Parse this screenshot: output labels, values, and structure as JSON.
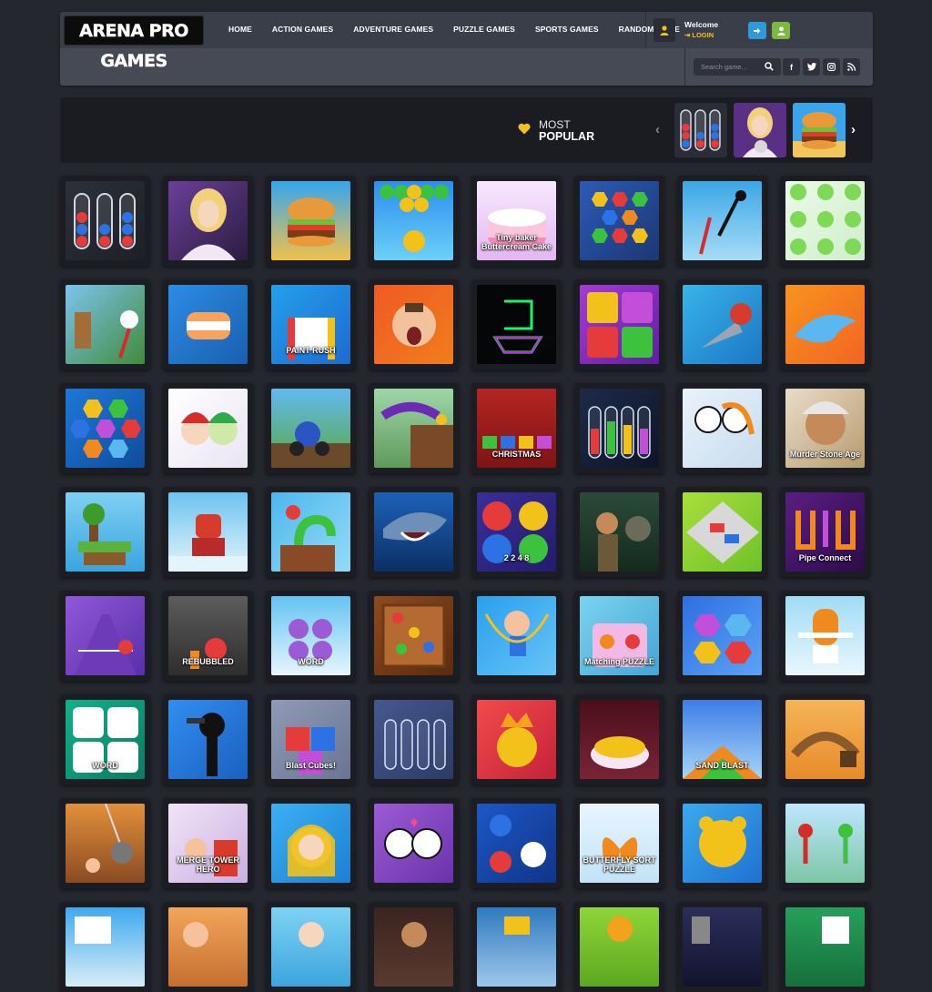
{
  "header": {
    "logo": "ARENA PRO GAMES",
    "nav": [
      "HOME",
      "ACTION GAMES",
      "ADVENTURE GAMES",
      "PUZZLE GAMES",
      "SPORTS GAMES",
      "RANDOM GAME"
    ],
    "welcome": "Welcome",
    "login": "LOGIN",
    "search_placeholder": "Search game...",
    "social": [
      "facebook-icon",
      "twitter-icon",
      "instagram-icon",
      "rss-icon"
    ],
    "colors": {
      "bar": "#3a3e48",
      "login": "#f4c21b",
      "blue": "#2c9bd8",
      "green": "#7cb93d"
    }
  },
  "popular": {
    "most": "MOST",
    "label": "POPULAR",
    "thumbs": [
      "ball sort tubes",
      "girl with cat",
      "burger stack"
    ]
  },
  "tiles": [
    {
      "bg": "linear-gradient(135deg,#2c3038,#1d2026)",
      "motif": "tubes"
    },
    {
      "bg": "linear-gradient(135deg,#6a3f9a,#2b1d40)",
      "motif": "girl"
    },
    {
      "bg": "linear-gradient(180deg,#35a6f0,#f1c04a)",
      "motif": "burger"
    },
    {
      "bg": "linear-gradient(180deg,#2b8ef0,#6cd0f7)",
      "motif": "bubbles"
    },
    {
      "bg": "linear-gradient(180deg,#f6e8ff,#e4b7f2)",
      "motif": "cake",
      "label": "Tiny baker Buttercream Cake"
    },
    {
      "bg": "linear-gradient(135deg,#2a5bb8,#1d3772)",
      "motif": "hex"
    },
    {
      "bg": "linear-gradient(180deg,#3ba7e6,#a7dcf6)",
      "motif": "stick"
    },
    {
      "bg": "linear-gradient(135deg,#eafbe6,#cfeecb)",
      "motif": "numbers"
    },
    {
      "bg": "linear-gradient(135deg,#7ec3ef,#3f8c3a)",
      "motif": "archer"
    },
    {
      "bg": "linear-gradient(135deg,#2b8de4,#1a5fb0)",
      "motif": "sushi"
    },
    {
      "bg": "linear-gradient(135deg,#24a0ea,#1e6ad0)",
      "motif": "paint",
      "label": "PAINT RUSH"
    },
    {
      "bg": "linear-gradient(135deg,#f15a22,#ef7d1d)",
      "motif": "scared"
    },
    {
      "bg": "#050608",
      "motif": "neon"
    },
    {
      "bg": "linear-gradient(135deg,#a43bd8,#5f1f9f)",
      "motif": "stars"
    },
    {
      "bg": "linear-gradient(135deg,#38b4e8,#1b77c6)",
      "motif": "drill"
    },
    {
      "bg": "linear-gradient(135deg,#f7931e,#f26522)",
      "motif": "dolphin"
    },
    {
      "bg": "linear-gradient(135deg,#1d78d8,#104c9c)",
      "motif": "hexnum"
    },
    {
      "bg": "linear-gradient(135deg,#ffffff,#e9e4f3)",
      "motif": "xmasfriends"
    },
    {
      "bg": "linear-gradient(180deg,#62b9f0,#5aa93f)",
      "motif": "hedgehog"
    },
    {
      "bg": "linear-gradient(180deg,#9fd6a8,#5f9a5b)",
      "motif": "worm"
    },
    {
      "bg": "linear-gradient(180deg,#b52423,#7e1415)",
      "motif": "christmas",
      "label": "CHRISTMAS"
    },
    {
      "bg": "linear-gradient(135deg,#1d2a4a,#0d1527)",
      "motif": "colortubes"
    },
    {
      "bg": "linear-gradient(135deg,#e8f2fa,#c8ddee)",
      "motif": "couple"
    },
    {
      "bg": "linear-gradient(135deg,#e9dcc8,#b79b6f)",
      "motif": "murder",
      "label": "Murder Stone Age"
    },
    {
      "bg": "linear-gradient(180deg,#7fd0f2,#3aa4df)",
      "motif": "island"
    },
    {
      "bg": "linear-gradient(180deg,#6dc3f0,#e4f4fb)",
      "motif": "robot"
    },
    {
      "bg": "linear-gradient(135deg,#4eb7ee,#94dbf7)",
      "motif": "snake"
    },
    {
      "bg": "linear-gradient(180deg,#1d61b8,#0d2f66)",
      "motif": "shark"
    },
    {
      "bg": "linear-gradient(135deg,#3a2e98,#241c6c)",
      "motif": "2248",
      "label": "2 2 4 8"
    },
    {
      "bg": "linear-gradient(180deg,#2b4a3a,#142a1f)",
      "motif": "jungle"
    },
    {
      "bg": "linear-gradient(135deg,#a8de3b,#6fc22a)",
      "motif": "cars"
    },
    {
      "bg": "linear-gradient(135deg,#5b1d84,#2c0c48)",
      "motif": "pipe",
      "label": "Pipe Connect"
    },
    {
      "bg": "linear-gradient(135deg,#8f58d9,#5a2fa8)",
      "motif": "tennis"
    },
    {
      "bg": "linear-gradient(180deg,#5c5c5c,#2e2e2e)",
      "motif": "bubbletrouble",
      "label": "REBUBBLED"
    },
    {
      "bg": "linear-gradient(180deg,#64c3f3,#e6f6ff)",
      "motif": "word",
      "label": "WORD"
    },
    {
      "bg": "linear-gradient(135deg,#8f4a1e,#5a2b0e)",
      "motif": "balls"
    },
    {
      "bg": "linear-gradient(135deg,#29a0ee,#67c4f5)",
      "motif": "rope"
    },
    {
      "bg": "linear-gradient(135deg,#7bd3ee,#44a6d6)",
      "motif": "matching",
      "label": "Matching PUZZLE"
    },
    {
      "bg": "linear-gradient(135deg,#2d6fe2,#5ba3f5)",
      "motif": "arrows"
    },
    {
      "bg": "linear-gradient(180deg,#9fdcf6,#e9f7fd)",
      "motif": "toilet"
    },
    {
      "bg": "linear-gradient(135deg,#0fb28a,#0a7b62)",
      "motif": "wordtiles",
      "label": "WORD"
    },
    {
      "bg": "linear-gradient(135deg,#2f8ff0,#1c5fc0)",
      "motif": "stickgun"
    },
    {
      "bg": "linear-gradient(135deg,#8f9ab7,#6a7592)",
      "motif": "blastcubes",
      "label": "Blast Cubes!"
    },
    {
      "bg": "linear-gradient(135deg,#45588e,#2c3b66)",
      "motif": "tubes2"
    },
    {
      "bg": "linear-gradient(135deg,#f24b4b,#c4223a)",
      "motif": "king"
    },
    {
      "bg": "linear-gradient(180deg,#4a0f1b,#7a2436)",
      "motif": "cakedeco"
    },
    {
      "bg": "linear-gradient(180deg,#3d7de6,#a7d6f6)",
      "motif": "sand",
      "label": "SAND BLAST"
    },
    {
      "bg": "linear-gradient(180deg,#f5b456,#e88b2a)",
      "motif": "tracks"
    },
    {
      "bg": "linear-gradient(180deg,#e2903a,#8a4b23)",
      "motif": "wrecking"
    },
    {
      "bg": "linear-gradient(135deg,#f2e4f6,#c9b0e3)",
      "motif": "merge",
      "label": "MERGE TOWER HERO"
    },
    {
      "bg": "linear-gradient(135deg,#3bb0f2,#1d80d3)",
      "motif": "princess"
    },
    {
      "bg": "linear-gradient(135deg,#9b5bd5,#6b33a8)",
      "motif": "kiss"
    },
    {
      "bg": "linear-gradient(135deg,#1d57c6,#0f3588)",
      "motif": "pool"
    },
    {
      "bg": "linear-gradient(180deg,#e8f5ff,#c2e3f6)",
      "motif": "butterfly",
      "label": "BUTTERFLY SORT PUZZLE"
    },
    {
      "bg": "linear-gradient(135deg,#3aa9ee,#1f72d0)",
      "motif": "bear"
    },
    {
      "bg": "linear-gradient(180deg,#bfe7ff,#7cc6a6)",
      "motif": "stickfight"
    },
    {
      "bg": "linear-gradient(180deg,#3ea9ee,#d8eef8)",
      "motif": "row8a"
    },
    {
      "bg": "linear-gradient(180deg,#f3a55a,#c56f30)",
      "motif": "row8b"
    },
    {
      "bg": "linear-gradient(180deg,#7dd3f2,#3da5de)",
      "motif": "row8c"
    },
    {
      "bg": "linear-gradient(180deg,#3a2420,#5a3a2e)",
      "motif": "row8d"
    },
    {
      "bg": "linear-gradient(180deg,#2f7ac0,#9ec7ea)",
      "motif": "row8e"
    },
    {
      "bg": "linear-gradient(180deg,#8fd53a,#5ca720)",
      "motif": "row8f"
    },
    {
      "bg": "linear-gradient(180deg,#2a2e5a,#12142e)",
      "motif": "row8g"
    },
    {
      "bg": "linear-gradient(180deg,#26a05a,#16703b)",
      "motif": "row8h"
    }
  ]
}
